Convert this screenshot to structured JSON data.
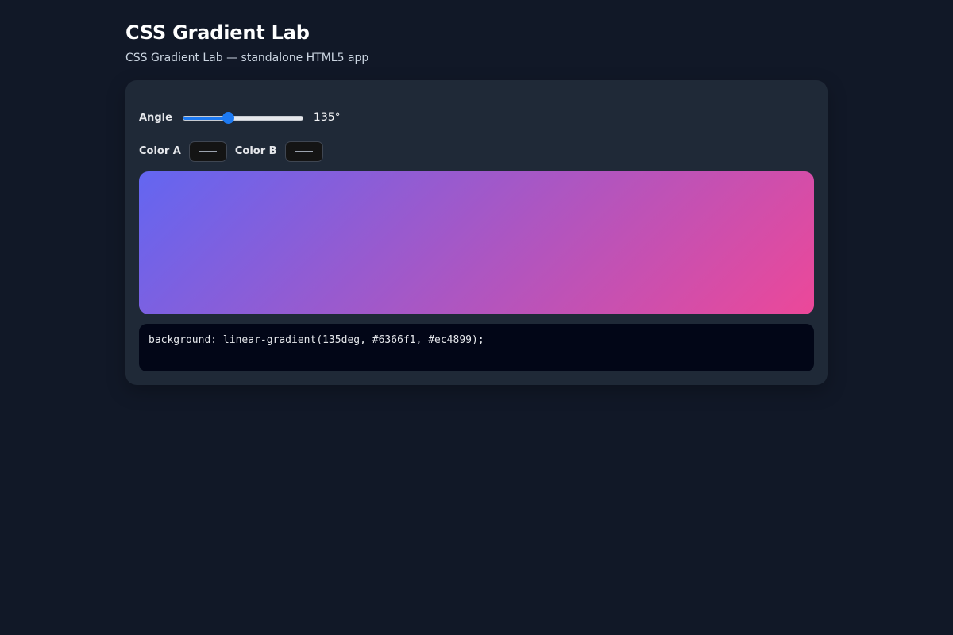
{
  "app": {
    "title": "CSS Gradient Lab",
    "subtitle": "CSS Gradient Lab — standalone HTML5 app"
  },
  "controls": {
    "angle_label": "Angle",
    "angle_value": 135,
    "angle_display": "135°",
    "angle_min": 0,
    "angle_max": 360,
    "color_a_label": "Color A",
    "color_a_value": "#6366f1",
    "color_b_label": "Color B",
    "color_b_value": "#ec4899"
  },
  "output": {
    "css": "background: linear-gradient(135deg, #6366f1, #ec4899);"
  },
  "colors": {
    "background": "#111827",
    "card": "#1f2937",
    "accent": "#1d7af3",
    "code_bg": "#020617"
  }
}
